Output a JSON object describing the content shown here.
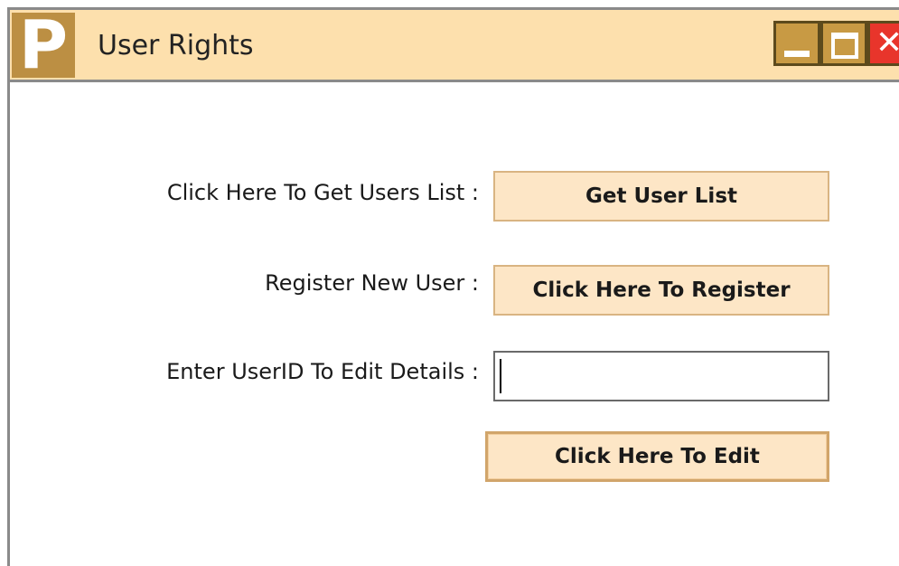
{
  "window": {
    "title": "User Rights",
    "app_icon_letter": "P",
    "controls": {
      "minimize_icon": "minimize-icon",
      "maximize_icon": "maximize-icon",
      "close_icon": "close-icon",
      "close_glyph": "✕"
    }
  },
  "form": {
    "get_users_label": "Click Here To Get Users List  :",
    "get_users_button": "Get User List",
    "register_label": "Register New User :",
    "register_button": "Click Here To Register",
    "edit_label": "Enter UserID To Edit Details :",
    "edit_input_value": "",
    "edit_input_placeholder": "",
    "edit_button": "Click Here To Edit"
  },
  "colors": {
    "titlebar": "#fde0ad",
    "icon_bg": "#bc8f43",
    "button_bg": "#fde6c6",
    "close_bg": "#e8352b"
  }
}
